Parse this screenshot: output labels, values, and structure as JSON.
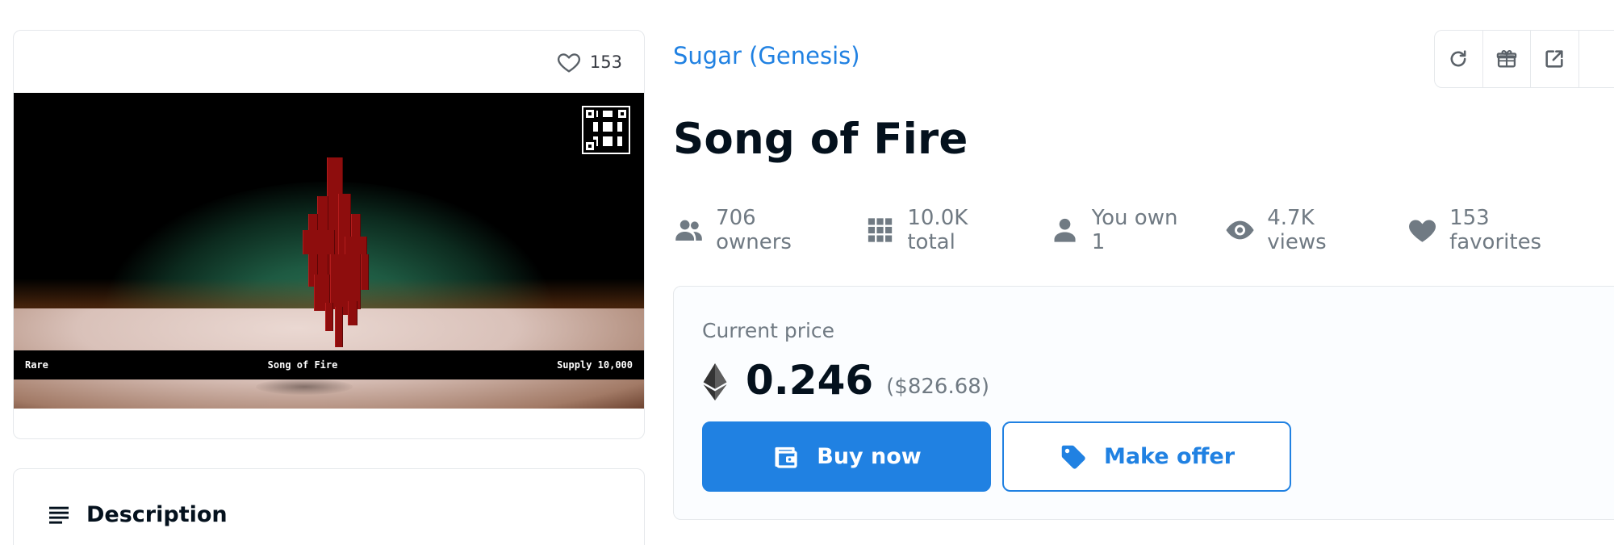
{
  "favorites_badge": {
    "icon": "heart-outline-icon",
    "count": "153"
  },
  "artwork": {
    "caption_left": "Rare",
    "caption_center": "Song of Fire",
    "caption_right": "Supply 10,000",
    "accent_bar_color": "#2bdc4a"
  },
  "description": {
    "icon": "list-icon",
    "title": "Description"
  },
  "collection_link": "Sugar (Genesis)",
  "toolbar": {
    "buttons": [
      {
        "icon": "refresh-icon"
      },
      {
        "icon": "gift-icon"
      },
      {
        "icon": "external-link-icon"
      }
    ]
  },
  "item_title": "Song of Fire",
  "stats": [
    {
      "icon": "owners-icon",
      "text": "706 owners"
    },
    {
      "icon": "grid-icon",
      "text": "10.0K total"
    },
    {
      "icon": "person-icon",
      "text": "You own 1"
    },
    {
      "icon": "eye-icon",
      "text": "4.7K views"
    },
    {
      "icon": "heart-filled-icon",
      "text": "153 favorites"
    }
  ],
  "price": {
    "label": "Current price",
    "currency_icon": "ethereum-icon",
    "amount": "0.246",
    "usd": "($826.68)"
  },
  "buttons": {
    "buy": {
      "icon": "wallet-icon",
      "label": "Buy now"
    },
    "offer": {
      "icon": "tag-icon",
      "label": "Make offer"
    }
  },
  "colors": {
    "accent": "#2081e2",
    "text": "#04111d",
    "muted": "#707a83",
    "border": "#e5e8eb"
  }
}
